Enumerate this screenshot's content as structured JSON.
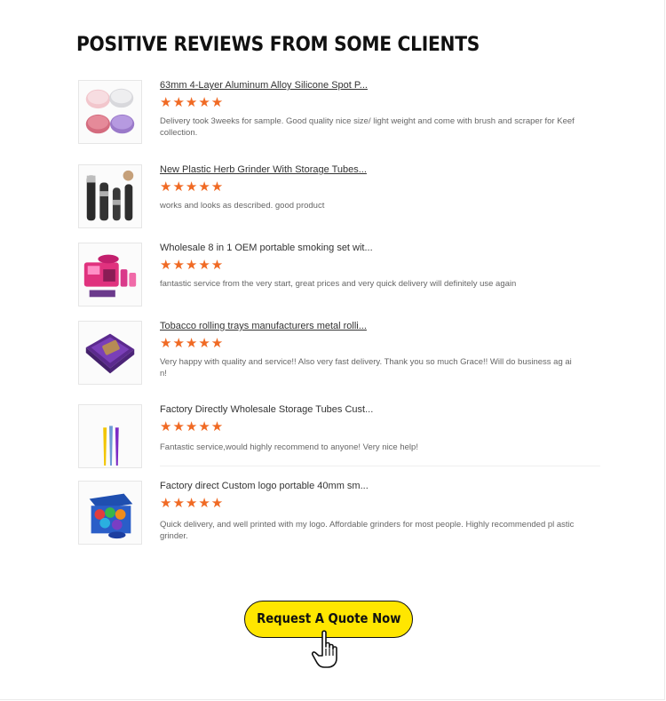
{
  "section": {
    "title": "POSITIVE REVIEWS FROM SOME CLIENTS"
  },
  "reviews": [
    {
      "product": "63mm 4-Layer Aluminum Alloy Silicone Spot P...",
      "stars": "★★★★★",
      "rating": 5,
      "text": "Delivery took 3weeks for sample. Good quality nice size/ light weight and come with brush and scraper for Keef collection."
    },
    {
      "product": "New Plastic Herb Grinder With Storage Tubes...",
      "stars": "★★★★★",
      "rating": 5,
      "text": "works and looks as described. good product"
    },
    {
      "product": "Wholesale 8 in 1 OEM portable smoking set wit...",
      "stars": "★★★★★",
      "rating": 5,
      "text": "fantastic service from the very start, great prices and very quick delivery will definitely use again"
    },
    {
      "product": "Tobacco rolling trays manufacturers metal rolli...",
      "stars": "★★★★★",
      "rating": 5,
      "text": "Very happy with quality and service!! Also very fast delivery. Thank you so much Grace!! Will do business ag ain!"
    },
    {
      "product": "Factory Directly Wholesale Storage Tubes Cust...",
      "stars": "★★★★★",
      "rating": 5,
      "text": "Fantastic service,would highly recommend to anyone! Very nice help!"
    },
    {
      "product": "Factory direct Custom logo portable 40mm sm...",
      "stars": "★★★★★",
      "rating": 5,
      "text": "Quick delivery, and well printed with my logo. Affordable grinders for most people. Highly recommended pl astic grinder."
    }
  ],
  "cta": {
    "label": "Request A Quote Now",
    "icon": "hand-pointer-icon"
  },
  "colors": {
    "star": "#f06a24",
    "cta_bg": "#ffe600",
    "title": "#111111"
  }
}
